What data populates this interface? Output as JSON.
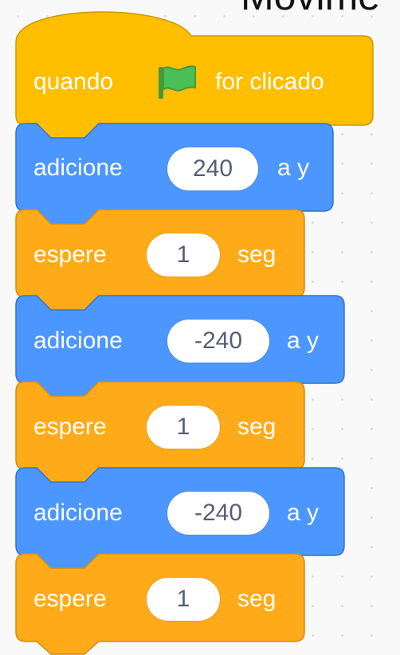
{
  "title": "Movime",
  "hat_block": {
    "label_before": "quando",
    "flag_icon": "green-flag-icon",
    "label_after": "for clicado"
  },
  "blocks": [
    {
      "type": "motion",
      "label": "adicione",
      "value": "240",
      "suffix": "a y"
    },
    {
      "type": "control",
      "label": "espere",
      "value": "1",
      "suffix": "seg"
    },
    {
      "type": "motion",
      "label": "adicione",
      "value": "-240",
      "suffix": "a y"
    },
    {
      "type": "control",
      "label": "espere",
      "value": "1",
      "suffix": "seg"
    },
    {
      "type": "motion",
      "label": "adicione",
      "value": "-240",
      "suffix": "a y"
    },
    {
      "type": "control",
      "label": "espere",
      "value": "1",
      "suffix": "seg"
    }
  ],
  "colors": {
    "events": "#ffbf00",
    "motion": "#4c97ff",
    "control": "#ffab19",
    "flag": "#4cbf56",
    "input_text": "#575e75"
  }
}
